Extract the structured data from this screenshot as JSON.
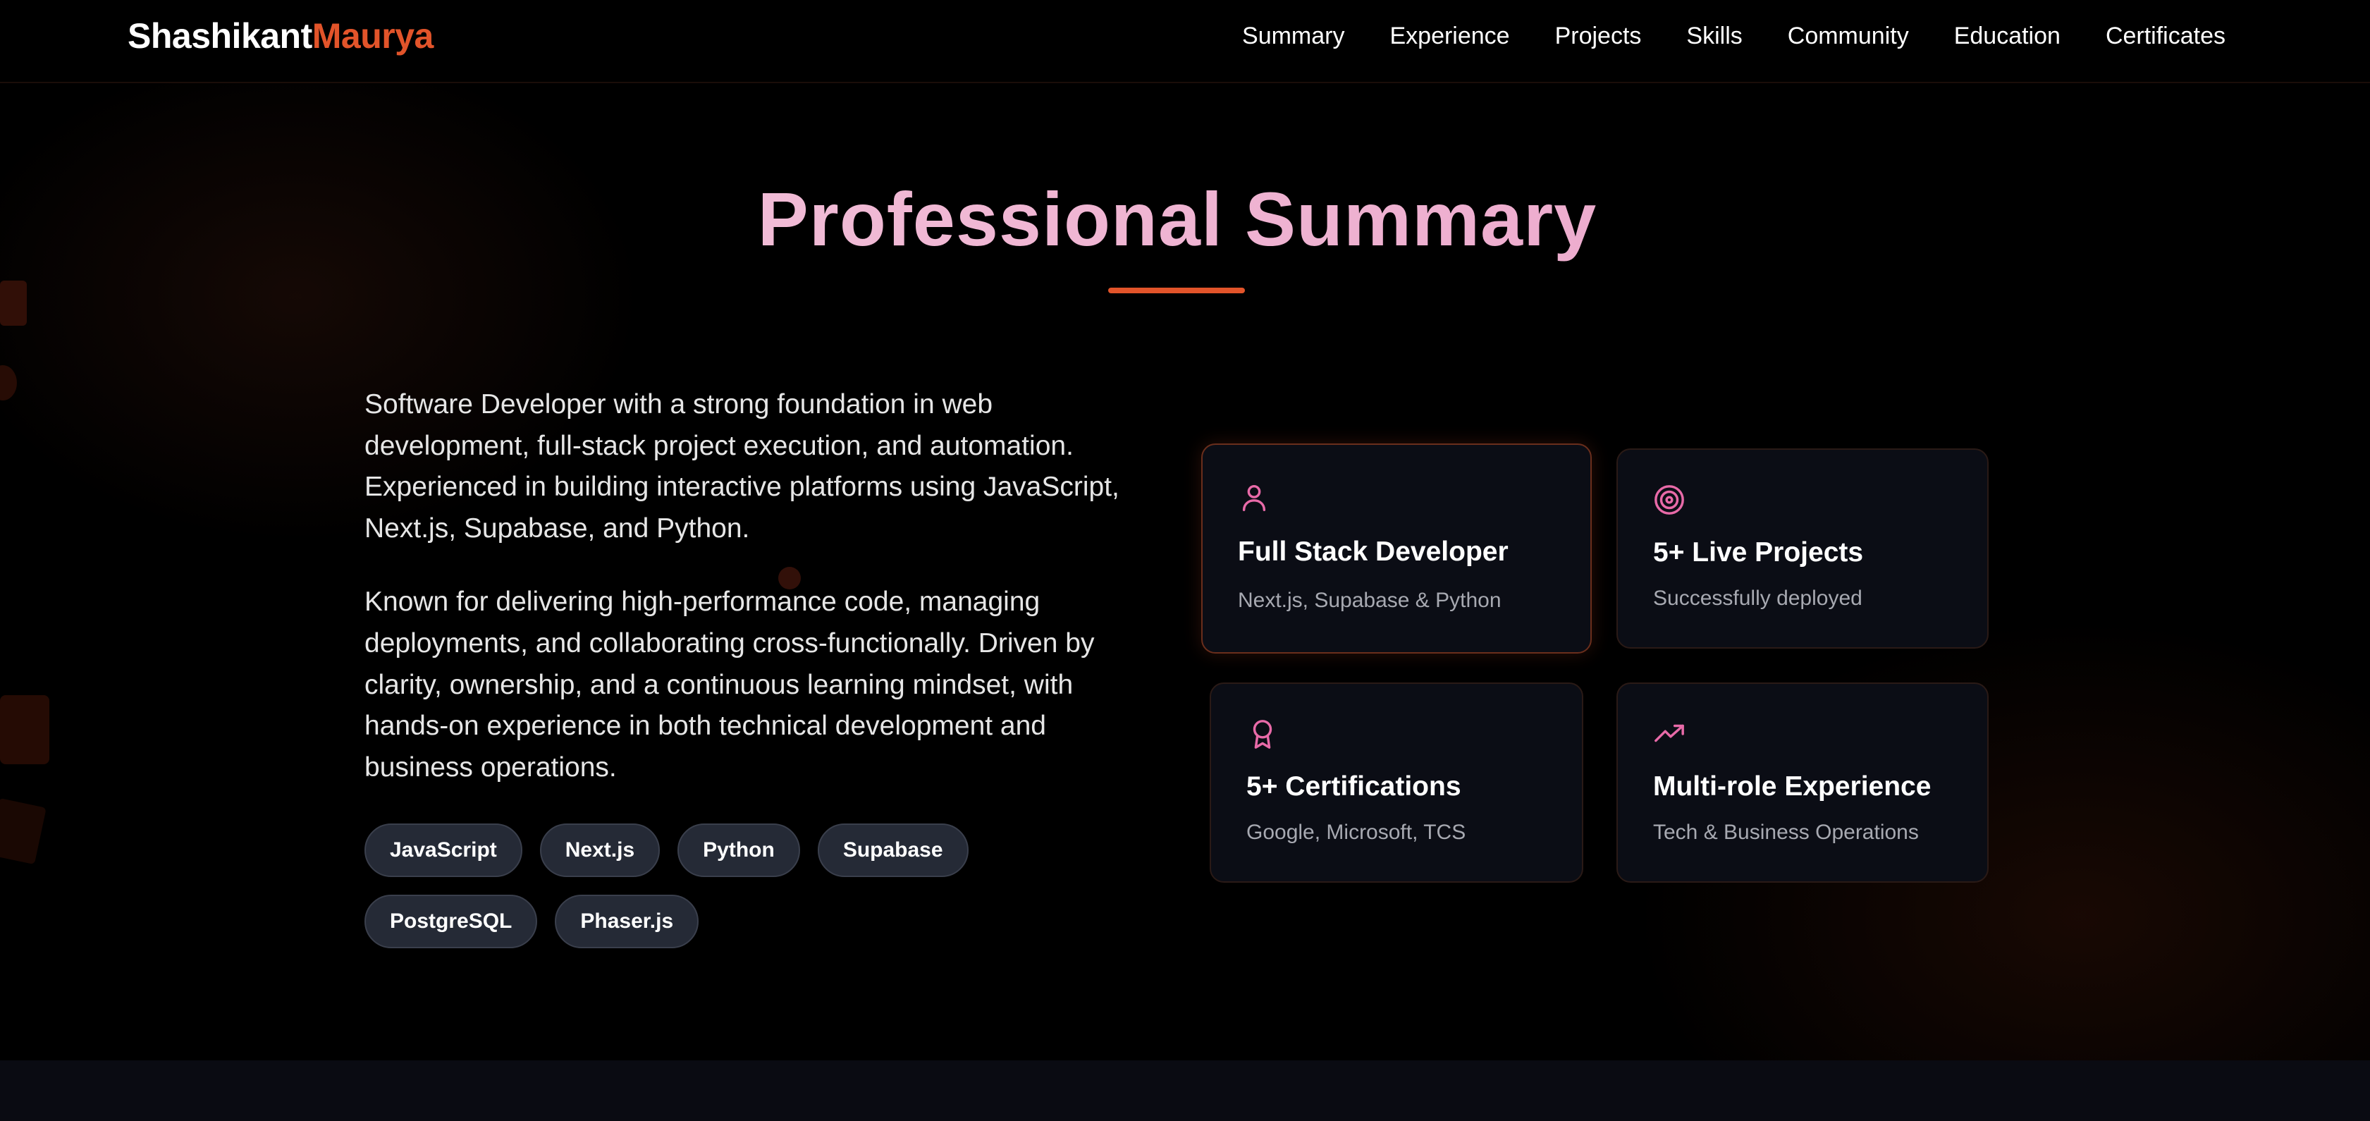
{
  "brand": {
    "first": "Shashikant",
    "last": "Maurya",
    "accent_color": "#e2542a"
  },
  "nav": {
    "items": [
      "Summary",
      "Experience",
      "Projects",
      "Skills",
      "Community",
      "Education",
      "Certificates"
    ]
  },
  "section": {
    "title": "Professional Summary",
    "paragraphs": [
      "Software Developer with a strong foundation in web development, full-stack project execution, and automation. Experienced in building interactive platforms using JavaScript, Next.js, Supabase, and Python.",
      "Known for delivering high-performance code, managing deployments, and collaborating cross-functionally. Driven by clarity, ownership, and a continuous learning mindset, with hands-on experience in both technical development and business operations."
    ],
    "tags": [
      "JavaScript",
      "Next.js",
      "Python",
      "Supabase",
      "PostgreSQL",
      "Phaser.js"
    ]
  },
  "cards": [
    {
      "icon": "user-icon",
      "title": "Full Stack Developer",
      "subtitle": "Next.js, Supabase & Python"
    },
    {
      "icon": "target-icon",
      "title": "5+ Live Projects",
      "subtitle": "Successfully deployed"
    },
    {
      "icon": "award-icon",
      "title": "5+ Certifications",
      "subtitle": "Google, Microsoft, TCS"
    },
    {
      "icon": "trending-up-icon",
      "title": "Multi-role Experience",
      "subtitle": "Tech & Business Operations"
    }
  ],
  "colors": {
    "icon": "#e86aa8",
    "title_gradient_start": "#f4c8dc",
    "title_gradient_end": "#eaa0c8"
  }
}
